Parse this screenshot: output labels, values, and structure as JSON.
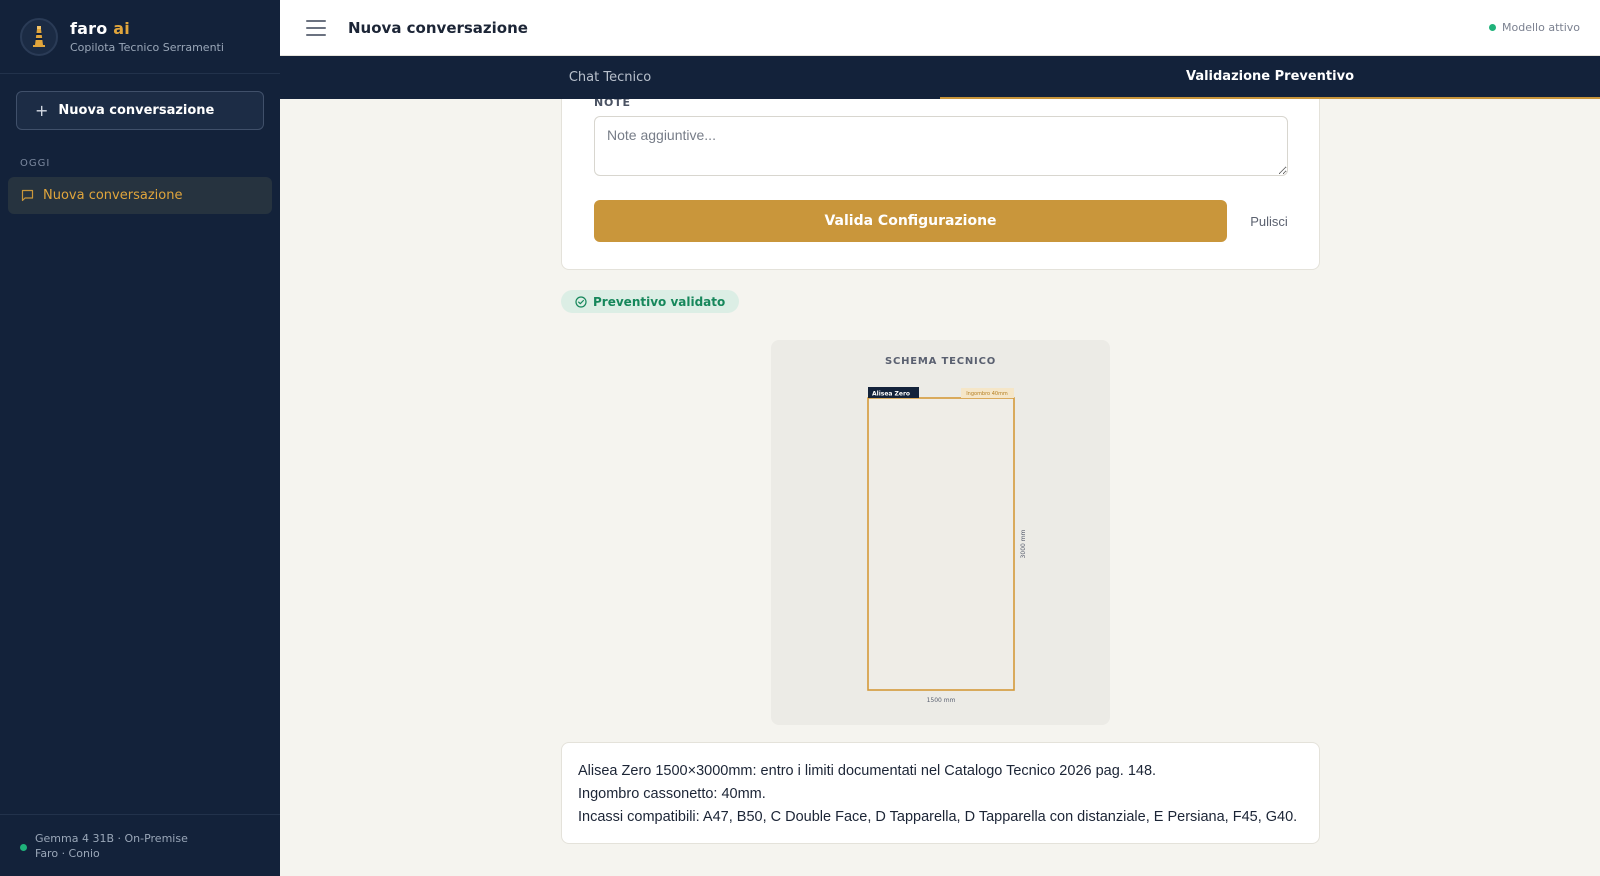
{
  "app": {
    "brand_name": "faro",
    "brand_accent": "ai",
    "brand_subtitle": "Copilota Tecnico Serramenti",
    "accent_color": "#c9963b",
    "sidebar_color": "#13223a"
  },
  "sidebar": {
    "new_chat_label": "Nuova conversazione",
    "section_label": "OGGI",
    "conversations": [
      {
        "label": "Nuova conversazione",
        "active": true
      }
    ],
    "footer_line1": "Gemma 4 31B · On-Premise",
    "footer_line2": "Faro · Conio"
  },
  "header": {
    "title": "Nuova conversazione",
    "status_label": "Modello attivo"
  },
  "tabs": [
    {
      "label": "Chat Tecnico",
      "active": false
    },
    {
      "label": "Validazione Preventivo",
      "active": true
    }
  ],
  "form": {
    "note_label": "NOTE",
    "note_placeholder": "Note aggiuntive...",
    "note_value": "",
    "validate_label": "Valida Configurazione",
    "clear_label": "Pulisci"
  },
  "badge": {
    "label": "Preventivo validato"
  },
  "schema": {
    "title": "SCHEMA TECNICO",
    "product_tag": "Alisea Zero",
    "ingombro_tag": "Ingombro 40mm",
    "width_label": "1500 mm",
    "height_label": "3000 mm",
    "width_mm": 1500,
    "height_mm": 3000
  },
  "summary": {
    "lines": [
      "Alisea Zero 1500×3000mm: entro i limiti documentati nel Catalogo Tecnico 2026 pag. 148.",
      "Ingombro cassonetto: 40mm.",
      "Incassi compatibili: A47, B50, C Double Face, D Tapparella, D Tapparella con distanziale, E Persiana, F45, G40."
    ]
  }
}
